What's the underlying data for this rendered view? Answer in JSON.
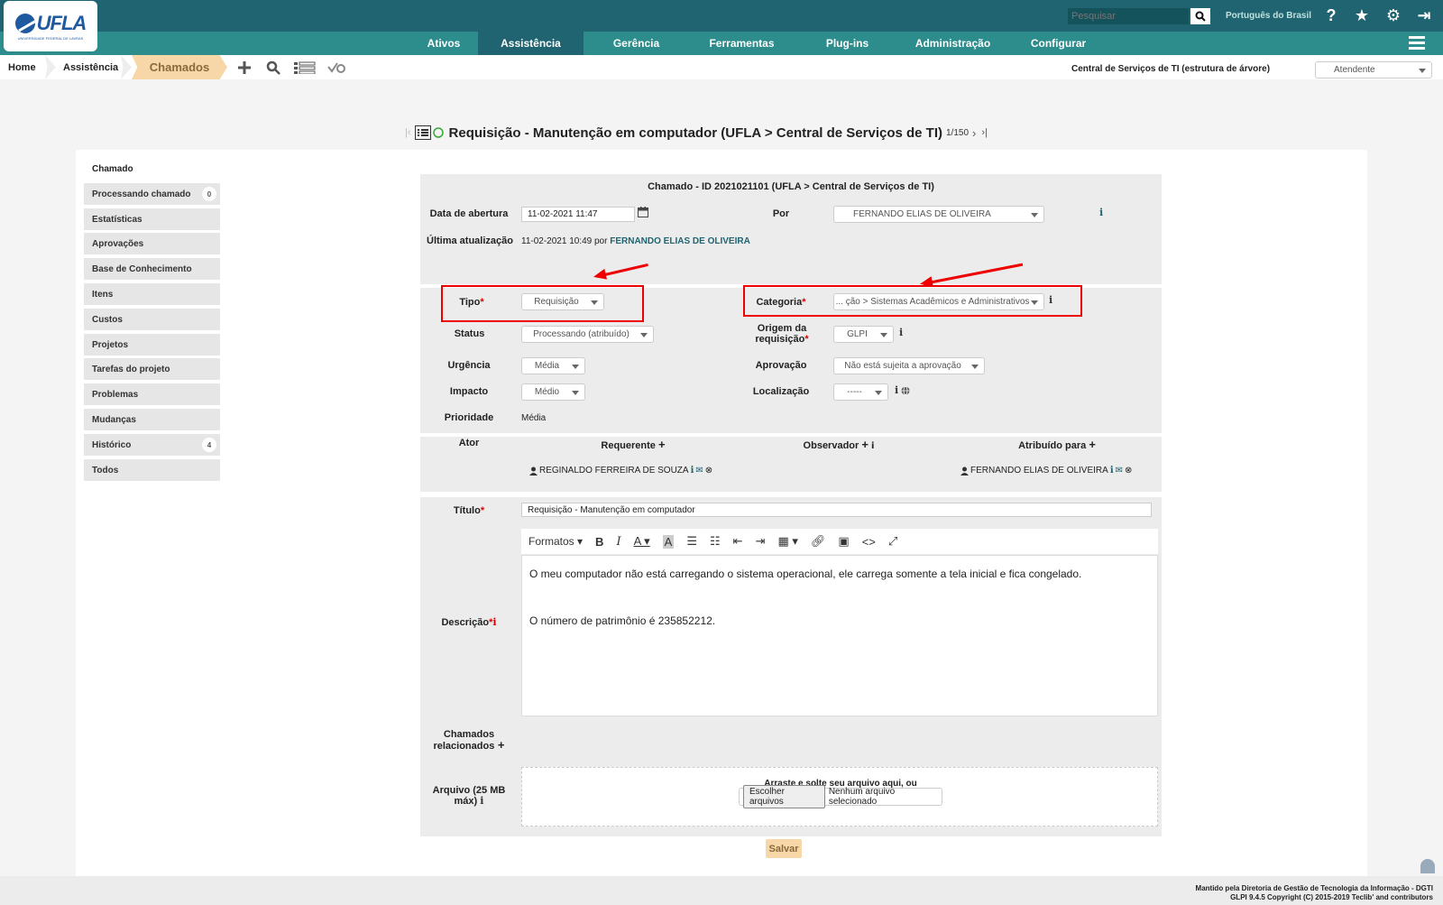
{
  "header": {
    "logo_text": "UFLA",
    "logo_sub": "UNIVERSIDADE FEDERAL DE LAVRAS",
    "search_placeholder": "Pesquisar",
    "language": "Português do Brasil",
    "icons": [
      "help-icon",
      "star-icon",
      "gear-icon",
      "logout-icon"
    ]
  },
  "menu": {
    "items": [
      "Ativos",
      "Assistência",
      "Gerência",
      "Ferramentas",
      "Plug-ins",
      "Administração",
      "Configurar"
    ],
    "active": "Assistência"
  },
  "breadcrumb": {
    "home": "Home",
    "section": "Assistência",
    "current": "Chamados"
  },
  "entity": "Central de Serviços de TI (estrutura de árvore)",
  "profile": "Atendente",
  "page_title": "Requisição - Manutenção em computador (UFLA > Central de Serviços de TI)",
  "pager": "1/150",
  "sidebar": {
    "title": "Chamado",
    "tabs": [
      {
        "label": "Processando chamado",
        "badge": "0"
      },
      {
        "label": "Estatísticas",
        "badge": ""
      },
      {
        "label": "Aprovações",
        "badge": ""
      },
      {
        "label": "Base de Conhecimento",
        "badge": ""
      },
      {
        "label": "Itens",
        "badge": ""
      },
      {
        "label": "Custos",
        "badge": ""
      },
      {
        "label": "Projetos",
        "badge": ""
      },
      {
        "label": "Tarefas do projeto",
        "badge": ""
      },
      {
        "label": "Problemas",
        "badge": ""
      },
      {
        "label": "Mudanças",
        "badge": ""
      },
      {
        "label": "Histórico",
        "badge": "4"
      },
      {
        "label": "Todos",
        "badge": ""
      }
    ]
  },
  "form": {
    "header": "Chamado - ID 2021021101 (UFLA > Central de Serviços de TI)",
    "opening_label": "Data de abertura",
    "opening_value": "11-02-2021 11:47",
    "by_label": "Por",
    "by_value": "FERNANDO ELIAS DE OLIVEIRA",
    "last_update_label": "Última atualização",
    "last_update_value": "11-02-2021 10:49 por",
    "last_update_user": "FERNANDO ELIAS DE OLIVEIRA",
    "type_label": "Tipo",
    "type_value": "Requisição",
    "category_label": "Categoria",
    "category_value": "... ção > Sistemas Acadêmicos e Administrativos",
    "status_label": "Status",
    "status_value": "Processando (atribuído)",
    "origin_label_1": "Origem da",
    "origin_label_2": "requisição",
    "origin_value": "GLPI",
    "urgency_label": "Urgência",
    "urgency_value": "Média",
    "approval_label": "Aprovação",
    "approval_value": "Não está sujeita a aprovação",
    "impact_label": "Impacto",
    "impact_value": "Médio",
    "location_label": "Localização",
    "location_value": "-----",
    "priority_label": "Prioridade",
    "priority_value": "Média",
    "actor_label": "Ator",
    "requester_label": "Requerente",
    "observer_label": "Observador",
    "assigned_label": "Atribuído para",
    "requester_value": "REGINALDO FERREIRA DE SOUZA",
    "assigned_value": "FERNANDO ELIAS DE OLIVEIRA",
    "title_label": "Título",
    "title_value": "Requisição - Manutenção em computador",
    "description_label": "Descrição",
    "formats_label": "Formatos",
    "description_p1": "O meu computador não está carregando o sistema operacional, ele carrega somente a tela inicial e fica congelado.",
    "description_p2": "O número de patrimônio é 235852212.",
    "related_label_1": "Chamados",
    "related_label_2": "relacionados",
    "file_label_1": "Arquivo (25 MB",
    "file_label_2": "máx)",
    "dropzone_text": "Arraste e solte seu arquivo aqui, ou",
    "choose_files": "Escolher arquivos",
    "no_file": "Nenhum arquivo selecionado",
    "save": "Salvar"
  },
  "footer": {
    "line1": "Mantido pela Diretoria de Gestão de Tecnologia da Informação - DGTI",
    "line2": "GLPI 9.4.5 Copyright (C) 2015-2019 Teclib' and contributors"
  }
}
